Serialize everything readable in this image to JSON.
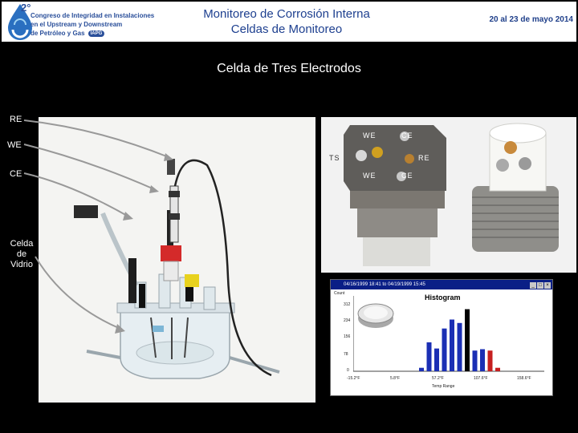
{
  "header": {
    "logo_year": "2°",
    "logo_line1": "Congreso de Integridad en Instalaciones",
    "logo_line2": "en el Upstream y Downstream",
    "logo_line3": "de Petróleo y Gas",
    "logo_badge": "IAPG",
    "title_line1": "Monitoreo de Corrosión Interna",
    "title_line2": "Celdas de Monitoreo",
    "date": "20 al 23 de mayo 2014"
  },
  "slide": {
    "subtitle": "Celda de Tres Electrodos",
    "labels": {
      "re": "RE",
      "we": "WE",
      "ce": "CE",
      "celda_line1": "Celda",
      "celda_line2": "de",
      "celda_line3": "Vidrio"
    },
    "probe_labels": {
      "we_top": "WE",
      "ce_top": "CE",
      "ts": "TS",
      "re": "RE",
      "we_bottom": "WE",
      "ce_bottom": "CE"
    },
    "histogram_window": {
      "date_from": "04/16/1999",
      "time_from": "18:41",
      "to": "to",
      "date_to": "04/19/1999",
      "time_to": "15:45",
      "title": "Histogram",
      "ylabel": "Count",
      "y_ticks": [
        "312",
        "234",
        "156",
        "78",
        "0"
      ],
      "x_ticks": [
        "-15.2°F",
        "5.8°F",
        "57.2°F",
        "107.6°F",
        "158.6°F"
      ],
      "xlabel": "Temp Range",
      "bar_colors": [
        "#1b2fb4",
        "#000000",
        "#c62020"
      ],
      "bars": [
        {
          "value": 0.05,
          "color": 0
        },
        {
          "value": 0.42,
          "color": 0
        },
        {
          "value": 0.33,
          "color": 0
        },
        {
          "value": 0.62,
          "color": 0
        },
        {
          "value": 0.75,
          "color": 0
        },
        {
          "value": 0.7,
          "color": 0
        },
        {
          "value": 0.9,
          "color": 1
        },
        {
          "value": 0.3,
          "color": 0
        },
        {
          "value": 0.32,
          "color": 0
        },
        {
          "value": 0.3,
          "color": 2
        },
        {
          "value": 0.05,
          "color": 2
        }
      ]
    }
  }
}
